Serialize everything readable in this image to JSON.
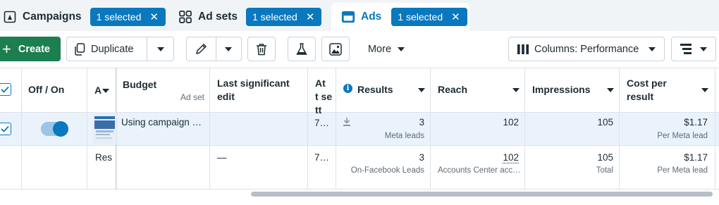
{
  "tabs": [
    {
      "label": "Campaigns",
      "icon": "campaign-flag-icon",
      "selected": "1 selected"
    },
    {
      "label": "Ad sets",
      "icon": "grid-icon",
      "selected": "1 selected"
    },
    {
      "label": "Ads",
      "icon": "ad-window-icon",
      "selected": "1 selected"
    }
  ],
  "toolbar": {
    "create_label": "Create",
    "duplicate_label": "Duplicate",
    "more_label": "More",
    "columns_label": "Columns: Performance"
  },
  "columns": {
    "off_on": "Off / On",
    "ad": "A",
    "budget": "Budget",
    "budget_sub": "Ad set",
    "last_edit": "Last significant edit",
    "attribution": "Att sett",
    "results": "Results",
    "reach": "Reach",
    "impressions": "Impressions",
    "cost_per_result": "Cost per result"
  },
  "rows": [
    {
      "budget": "Using campaign …",
      "attribution": "7…",
      "results": "3",
      "results_sub": "Meta leads",
      "reach": "102",
      "impressions": "105",
      "cost": "$1.17",
      "cost_sub": "Per Meta lead"
    },
    {
      "ad": "Res",
      "last_edit": "—",
      "attribution": "7…",
      "results": "3",
      "results_sub": "On-Facebook Leads",
      "reach": "102",
      "reach_sub": "Accounts Center acc…",
      "impressions": "105",
      "impressions_sub": "Total",
      "cost": "$1.17",
      "cost_sub": "Per Meta lead"
    }
  ],
  "colors": {
    "accent": "#0a78be",
    "create": "#1d7e4f",
    "selected_row": "#eaf3fc"
  }
}
